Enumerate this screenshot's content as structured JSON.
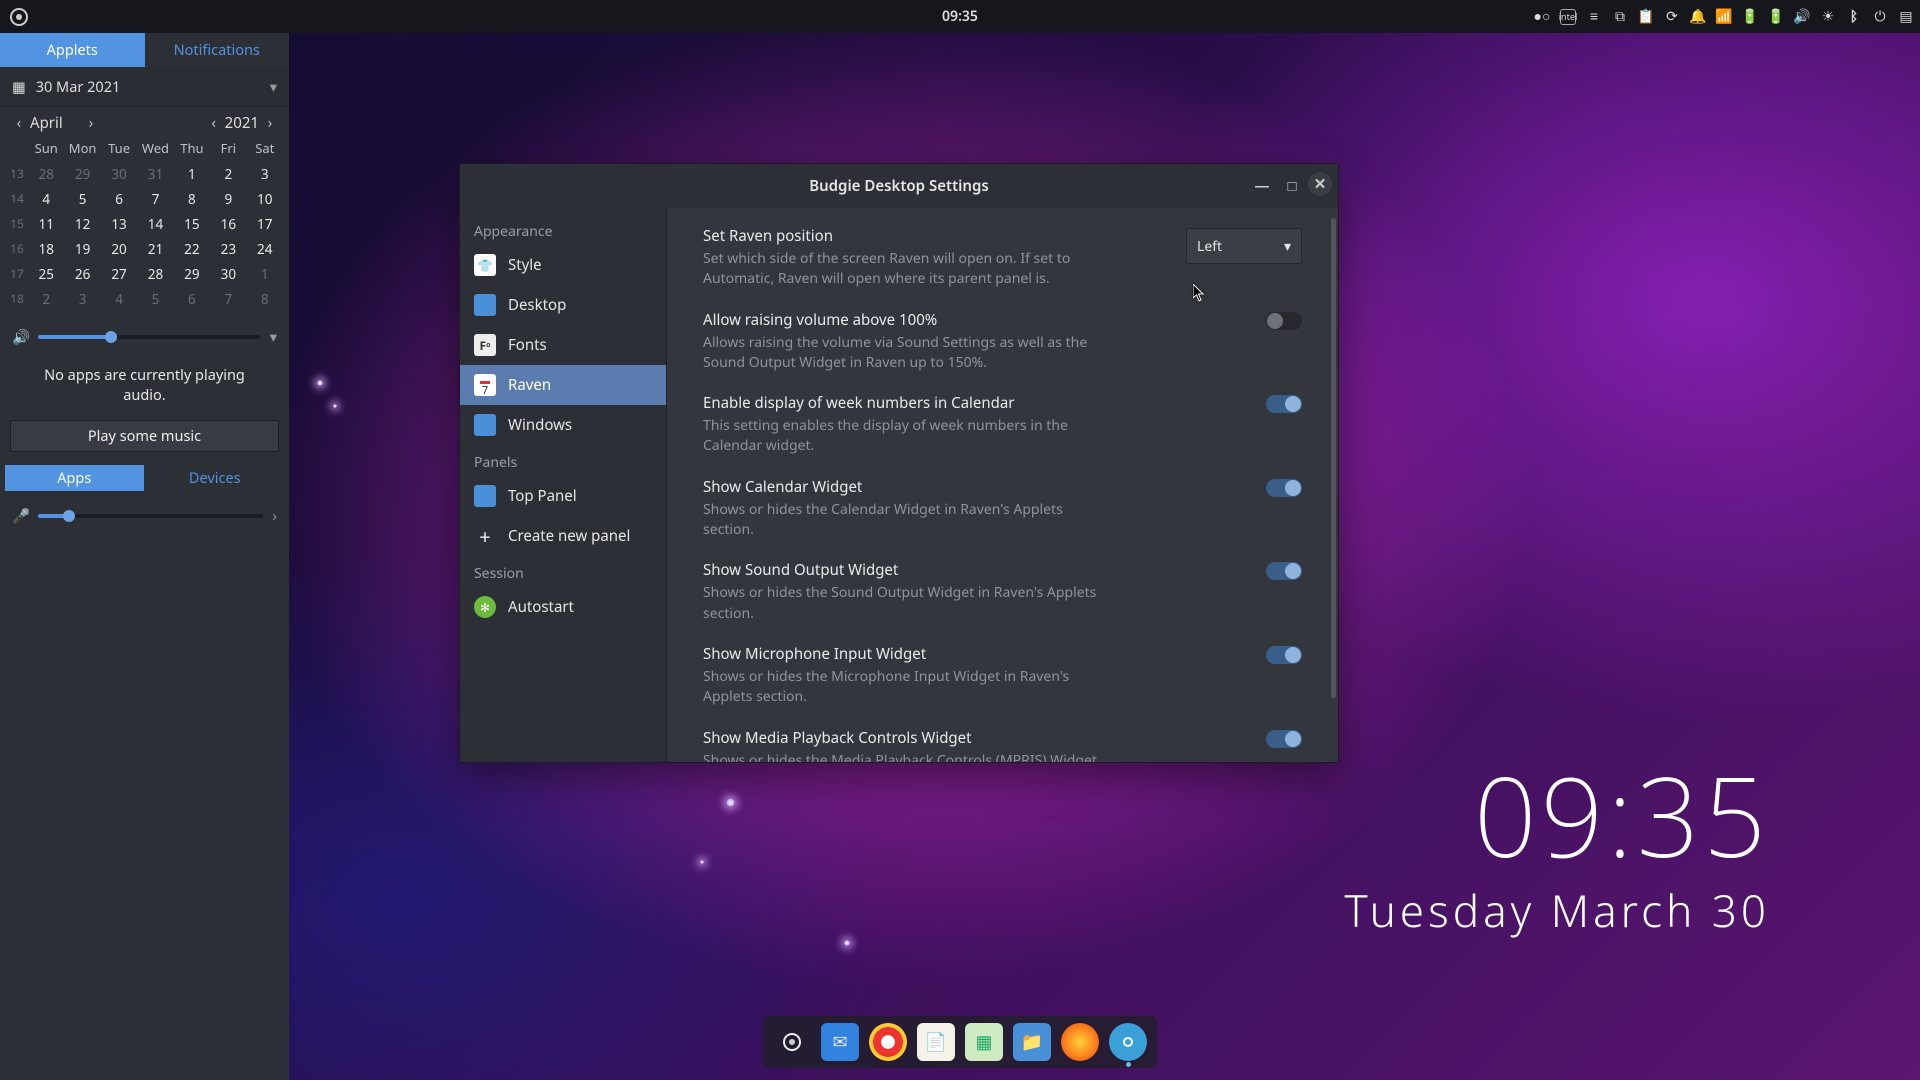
{
  "panel": {
    "clock": "09:35"
  },
  "raven": {
    "tabs": {
      "applets": "Applets",
      "notifications": "Notifications"
    },
    "date_selected": "30 Mar 2021",
    "month": "April",
    "year": "2021",
    "day_headers": [
      "Sun",
      "Mon",
      "Tue",
      "Wed",
      "Thu",
      "Fri",
      "Sat"
    ],
    "weeks": [
      {
        "wk": "13",
        "days": [
          {
            "n": "28",
            "dim": true
          },
          {
            "n": "29",
            "dim": true
          },
          {
            "n": "30",
            "dim": true
          },
          {
            "n": "31",
            "dim": true
          },
          {
            "n": "1"
          },
          {
            "n": "2"
          },
          {
            "n": "3"
          }
        ]
      },
      {
        "wk": "14",
        "days": [
          {
            "n": "4"
          },
          {
            "n": "5"
          },
          {
            "n": "6"
          },
          {
            "n": "7"
          },
          {
            "n": "8"
          },
          {
            "n": "9"
          },
          {
            "n": "10"
          }
        ]
      },
      {
        "wk": "15",
        "days": [
          {
            "n": "11"
          },
          {
            "n": "12"
          },
          {
            "n": "13"
          },
          {
            "n": "14"
          },
          {
            "n": "15"
          },
          {
            "n": "16"
          },
          {
            "n": "17"
          }
        ]
      },
      {
        "wk": "16",
        "days": [
          {
            "n": "18"
          },
          {
            "n": "19"
          },
          {
            "n": "20"
          },
          {
            "n": "21"
          },
          {
            "n": "22"
          },
          {
            "n": "23"
          },
          {
            "n": "24"
          }
        ]
      },
      {
        "wk": "17",
        "days": [
          {
            "n": "25"
          },
          {
            "n": "26"
          },
          {
            "n": "27"
          },
          {
            "n": "28"
          },
          {
            "n": "29"
          },
          {
            "n": "30"
          },
          {
            "n": "1",
            "dim": true
          }
        ]
      },
      {
        "wk": "18",
        "days": [
          {
            "n": "2",
            "dim": true
          },
          {
            "n": "3",
            "dim": true
          },
          {
            "n": "4",
            "dim": true
          },
          {
            "n": "5",
            "dim": true
          },
          {
            "n": "6",
            "dim": true
          },
          {
            "n": "7",
            "dim": true
          },
          {
            "n": "8",
            "dim": true
          }
        ]
      }
    ],
    "volume_percent": 33,
    "no_apps_line1": "No apps are currently playing",
    "no_apps_line2": "audio.",
    "play_music": "Play some music",
    "tabs2": {
      "apps": "Apps",
      "devices": "Devices"
    },
    "mic_percent": 14
  },
  "desktop_clock": {
    "time": "09:35",
    "date": "Tuesday March 30"
  },
  "window": {
    "title": "Budgie Desktop Settings",
    "sections": {
      "appearance": "Appearance",
      "panels": "Panels",
      "session": "Session"
    },
    "items": {
      "style": "Style",
      "desktop": "Desktop",
      "fonts": "Fonts",
      "raven": "Raven",
      "windows": "Windows",
      "top_panel": "Top Panel",
      "create_panel": "Create new panel",
      "autostart": "Autostart"
    },
    "settings": {
      "position": {
        "title": "Set Raven position",
        "desc": "Set which side of the screen Raven will open on. If set to Automatic, Raven will open where its parent panel is.",
        "value": "Left"
      },
      "volume": {
        "title": "Allow raising volume above 100%",
        "desc": "Allows raising the volume via Sound Settings as well as the Sound Output Widget in Raven up to 150%.",
        "on": false
      },
      "weeknum": {
        "title": "Enable display of week numbers in Calendar",
        "desc": "This setting enables the display of week numbers in the Calendar widget.",
        "on": true
      },
      "cal": {
        "title": "Show Calendar Widget",
        "desc": "Shows or hides the Calendar Widget in Raven's Applets section.",
        "on": true
      },
      "sound": {
        "title": "Show Sound Output Widget",
        "desc": "Shows or hides the Sound Output Widget in Raven's Applets section.",
        "on": true
      },
      "mic": {
        "title": "Show Microphone Input Widget",
        "desc": "Shows or hides the Microphone Input Widget in Raven's Applets section.",
        "on": true
      },
      "media": {
        "title": "Show Media Playback Controls Widget",
        "desc": "Shows or hides the Media Playback Controls (MPRIS) Widget in Raven's Applets section.",
        "on": true
      }
    }
  }
}
